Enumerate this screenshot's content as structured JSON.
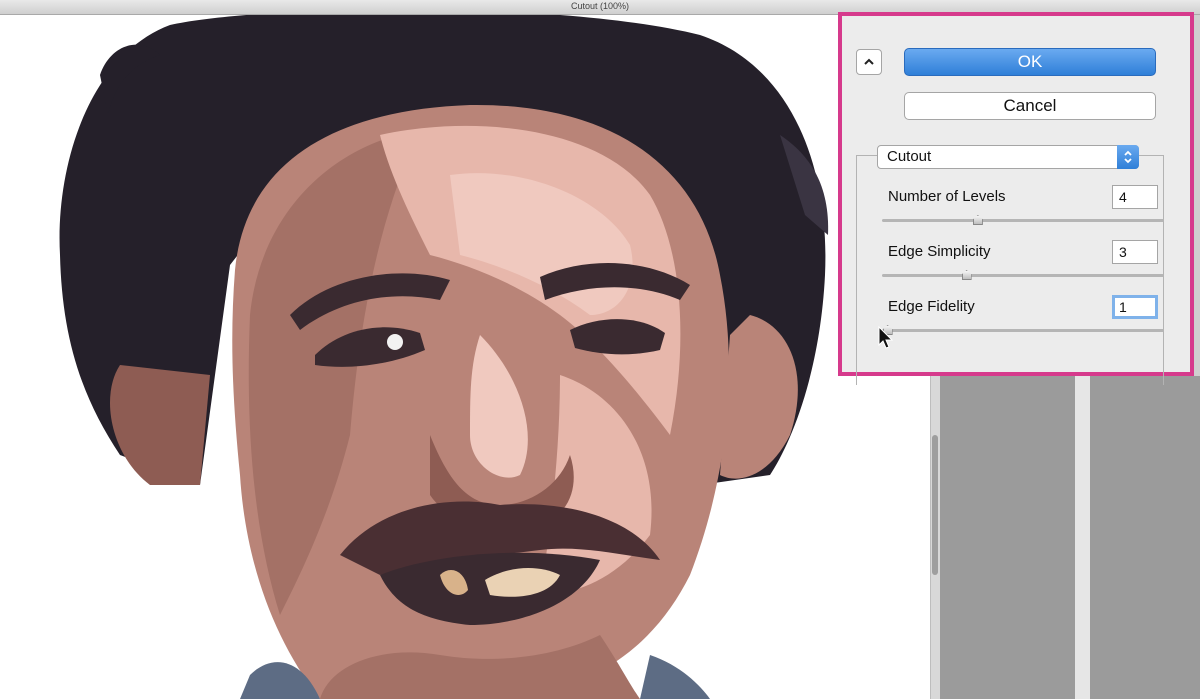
{
  "window": {
    "title": "Cutout (100%)"
  },
  "dialog": {
    "ok_label": "OK",
    "cancel_label": "Cancel",
    "collapse_icon": "chevron-up-icon",
    "filter_select": {
      "selected": "Cutout"
    },
    "params": [
      {
        "label": "Number of Levels",
        "value": "4",
        "slider_fraction": 0.34
      },
      {
        "label": "Edge Simplicity",
        "value": "3",
        "slider_fraction": 0.3
      },
      {
        "label": "Edge Fidelity",
        "value": "1",
        "slider_fraction": 0.02
      }
    ]
  },
  "colors": {
    "highlight_frame": "#d63a8c",
    "ok_button": "#3c86dc",
    "hair": "#25202a",
    "skin_light": "#e7b7ab",
    "skin_mid": "#b98478"
  }
}
